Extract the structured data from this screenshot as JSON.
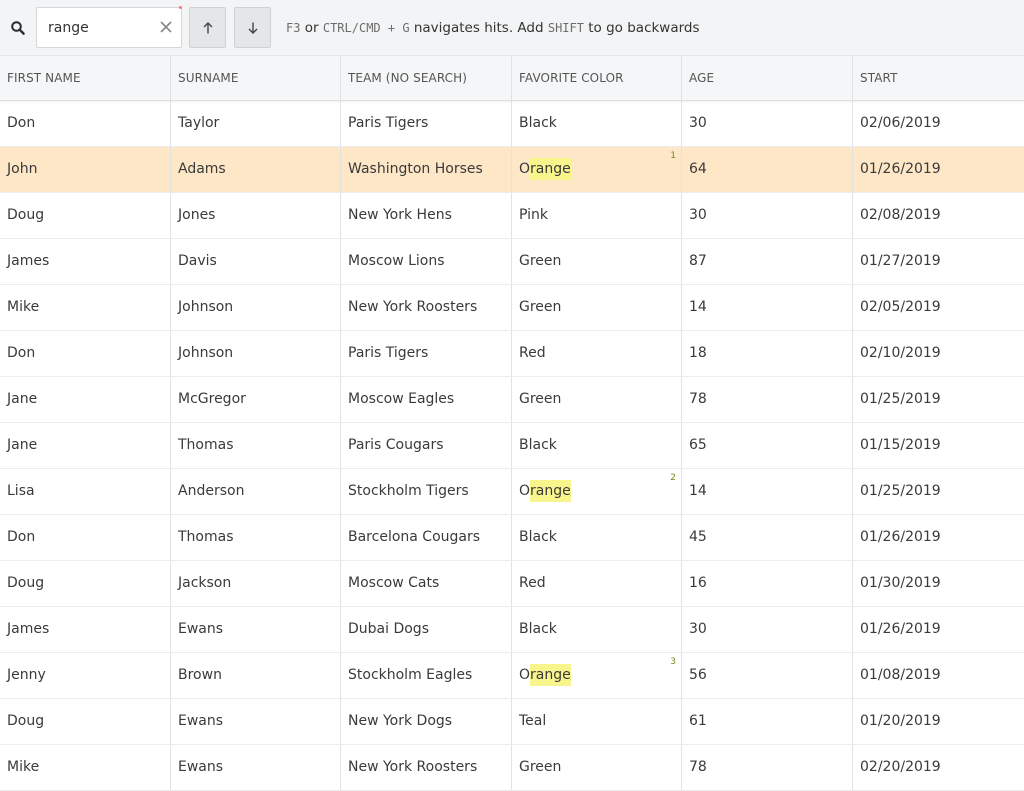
{
  "search": {
    "value": "range",
    "up_symbol": "↑",
    "down_symbol": "↓",
    "hint": [
      {
        "text": "F3",
        "mono": true
      },
      {
        "text": " or ",
        "mono": false
      },
      {
        "text": "CTRL/CMD + G",
        "mono": true
      },
      {
        "text": " navigates hits. Add ",
        "mono": false
      },
      {
        "text": "SHIFT",
        "mono": true
      },
      {
        "text": " to go backwards",
        "mono": false
      }
    ]
  },
  "grid": {
    "columns": [
      "First Name",
      "Surname",
      "Team (no search)",
      "Favorite Color",
      "Age",
      "Start"
    ],
    "rows": [
      {
        "cells": [
          "Don",
          "Taylor",
          "Paris Tigers",
          "Black",
          "30",
          "02/06/2019"
        ]
      },
      {
        "cells": [
          "John",
          "Adams",
          "Washington Horses",
          "Orange",
          "64",
          "01/26/2019"
        ],
        "selected": true,
        "hit": {
          "col": 3,
          "pre": "O",
          "match": "range",
          "post": "",
          "badge": "1"
        }
      },
      {
        "cells": [
          "Doug",
          "Jones",
          "New York Hens",
          "Pink",
          "30",
          "02/08/2019"
        ]
      },
      {
        "cells": [
          "James",
          "Davis",
          "Moscow Lions",
          "Green",
          "87",
          "01/27/2019"
        ]
      },
      {
        "cells": [
          "Mike",
          "Johnson",
          "New York Roosters",
          "Green",
          "14",
          "02/05/2019"
        ]
      },
      {
        "cells": [
          "Don",
          "Johnson",
          "Paris Tigers",
          "Red",
          "18",
          "02/10/2019"
        ]
      },
      {
        "cells": [
          "Jane",
          "McGregor",
          "Moscow Eagles",
          "Green",
          "78",
          "01/25/2019"
        ]
      },
      {
        "cells": [
          "Jane",
          "Thomas",
          "Paris Cougars",
          "Black",
          "65",
          "01/15/2019"
        ]
      },
      {
        "cells": [
          "Lisa",
          "Anderson",
          "Stockholm Tigers",
          "Orange",
          "14",
          "01/25/2019"
        ],
        "hit": {
          "col": 3,
          "pre": "O",
          "match": "range",
          "post": "",
          "badge": "2"
        }
      },
      {
        "cells": [
          "Don",
          "Thomas",
          "Barcelona Cougars",
          "Black",
          "45",
          "01/26/2019"
        ]
      },
      {
        "cells": [
          "Doug",
          "Jackson",
          "Moscow Cats",
          "Red",
          "16",
          "01/30/2019"
        ]
      },
      {
        "cells": [
          "James",
          "Ewans",
          "Dubai Dogs",
          "Black",
          "30",
          "01/26/2019"
        ]
      },
      {
        "cells": [
          "Jenny",
          "Brown",
          "Stockholm Eagles",
          "Orange",
          "56",
          "01/08/2019"
        ],
        "hit": {
          "col": 3,
          "pre": "O",
          "match": "range",
          "post": "",
          "badge": "3"
        }
      },
      {
        "cells": [
          "Doug",
          "Ewans",
          "New York Dogs",
          "Teal",
          "61",
          "01/20/2019"
        ]
      },
      {
        "cells": [
          "Mike",
          "Ewans",
          "New York Roosters",
          "Green",
          "78",
          "02/20/2019"
        ]
      }
    ]
  },
  "colors": {
    "selected_row": "#fde7c6",
    "highlight": "#f8f58c",
    "badge": "#6e8c1b"
  }
}
